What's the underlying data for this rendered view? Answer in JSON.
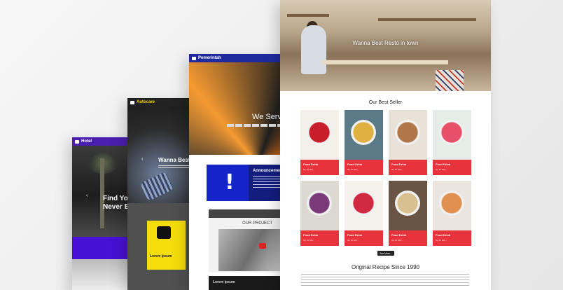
{
  "hotel": {
    "topbar_label": "Hotel",
    "hero_text": "Find Your Never B",
    "nav_arrow": "‹"
  },
  "autocare": {
    "topbar_label": "Autocare",
    "hero_text": "Wanna Best Ga",
    "nav_arrow": "‹",
    "feature_text": "Lorem ipsum"
  },
  "pemerintah": {
    "topbar_label": "Pemerintah",
    "hero_text": "We Serve",
    "announcement_title": "Announcement",
    "announcement_mark": "!",
    "video_title": "OUR PROJECT",
    "footer_text": "Lorem ipsum"
  },
  "resto": {
    "hero_text": "Wanna Best Resto in town",
    "section_title": "Our Best Seller",
    "products": [
      {
        "name": "Food Drink",
        "price": "Rp 40.000,-",
        "color": "#c81e2a",
        "bg": "#f3f0ea"
      },
      {
        "name": "Food Drink",
        "price": "Rp 40.000,-",
        "color": "#e0b040",
        "bg": "#5a7a88"
      },
      {
        "name": "Food Drink",
        "price": "Rp 40.000,-",
        "color": "#b07848",
        "bg": "#e9e2d8"
      },
      {
        "name": "Food Drink",
        "price": "Rp 40.000,-",
        "color": "#e8506a",
        "bg": "#e6ece8"
      },
      {
        "name": "Food Drink",
        "price": "Rp 40.000,-",
        "color": "#7a3a7a",
        "bg": "#dcd8d2"
      },
      {
        "name": "Food Drink",
        "price": "Rp 40.000,-",
        "color": "#d02840",
        "bg": "#f5f2ee"
      },
      {
        "name": "Food Drink",
        "price": "Rp 40.000,-",
        "color": "#d8c090",
        "bg": "#6a5444"
      },
      {
        "name": "Food Drink",
        "price": "Rp 40.000,-",
        "color": "#e09050",
        "bg": "#eae6df"
      }
    ],
    "see_more": "See More...",
    "recipe_title": "Original Recipe Since 1990"
  }
}
